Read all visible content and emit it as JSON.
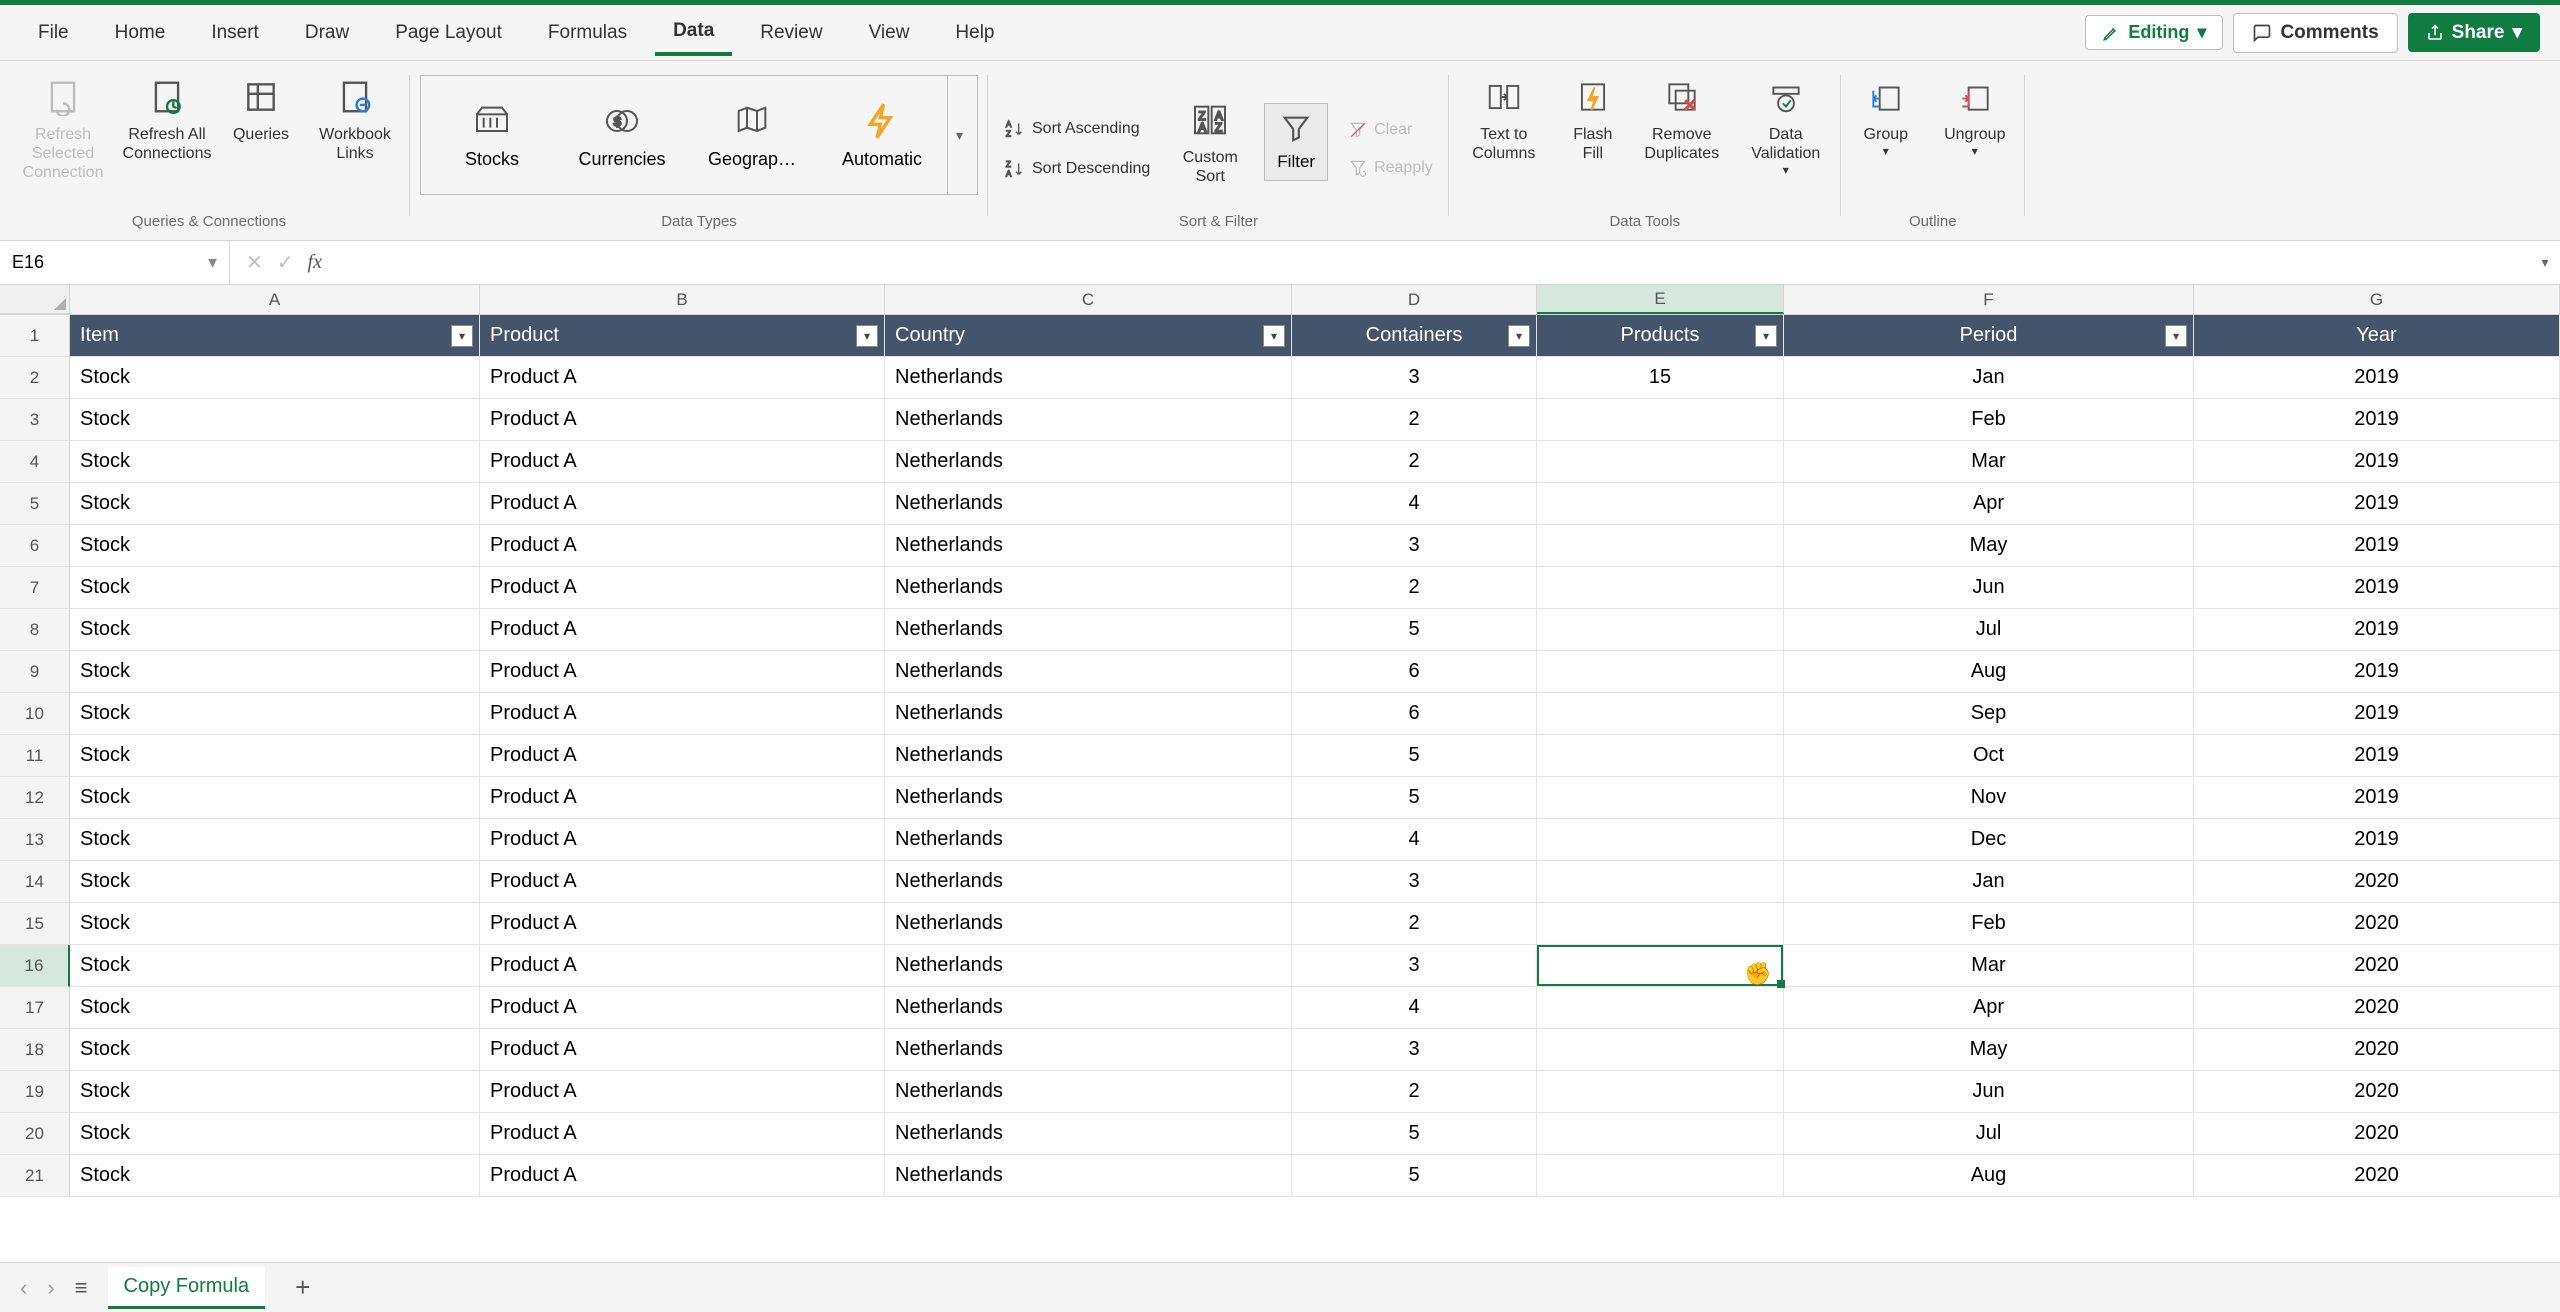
{
  "menu": {
    "file": "File",
    "home": "Home",
    "insert": "Insert",
    "draw": "Draw",
    "page_layout": "Page Layout",
    "formulas": "Formulas",
    "data": "Data",
    "review": "Review",
    "view": "View",
    "help": "Help"
  },
  "topright": {
    "editing": "Editing",
    "comments": "Comments",
    "share": "Share"
  },
  "ribbon": {
    "refresh_selected": "Refresh Selected Connection",
    "refresh_all": "Refresh All Connections",
    "queries": "Queries",
    "workbook_links": "Workbook Links",
    "group_qc": "Queries & Connections",
    "dt_stocks": "Stocks",
    "dt_currencies": "Currencies",
    "dt_geography": "Geograp…",
    "dt_automatic": "Automatic",
    "group_dt": "Data Types",
    "sort_asc": "Sort Ascending",
    "sort_desc": "Sort Descending",
    "custom_sort": "Custom Sort",
    "filter": "Filter",
    "clear": "Clear",
    "reapply": "Reapply",
    "group_sf": "Sort & Filter",
    "text_cols": "Text to Columns",
    "flash_fill": "Flash Fill",
    "remove_dup": "Remove Duplicates",
    "data_val": "Data Validation",
    "group_tools": "Data Tools",
    "group": "Group",
    "ungroup": "Ungroup",
    "group_outline": "Outline"
  },
  "name_box": "E16",
  "formula": "",
  "columns": [
    "A",
    "B",
    "C",
    "D",
    "E",
    "F",
    "G"
  ],
  "col_widths": [
    "cw-A",
    "cw-B",
    "cw-C",
    "cw-D",
    "cw-E",
    "cw-F",
    "cw-G"
  ],
  "headers": [
    "Item",
    "Product",
    "Country",
    "Containers",
    "Products",
    "Period",
    "Year"
  ],
  "filterable": [
    true,
    true,
    true,
    true,
    true,
    true,
    false
  ],
  "align": [
    "left",
    "left",
    "left",
    "center",
    "center",
    "center",
    "center"
  ],
  "rows": [
    [
      "Stock",
      "Product A",
      "Netherlands",
      "3",
      "15",
      "Jan",
      "2019"
    ],
    [
      "Stock",
      "Product A",
      "Netherlands",
      "2",
      "",
      "Feb",
      "2019"
    ],
    [
      "Stock",
      "Product A",
      "Netherlands",
      "2",
      "",
      "Mar",
      "2019"
    ],
    [
      "Stock",
      "Product A",
      "Netherlands",
      "4",
      "",
      "Apr",
      "2019"
    ],
    [
      "Stock",
      "Product A",
      "Netherlands",
      "3",
      "",
      "May",
      "2019"
    ],
    [
      "Stock",
      "Product A",
      "Netherlands",
      "2",
      "",
      "Jun",
      "2019"
    ],
    [
      "Stock",
      "Product A",
      "Netherlands",
      "5",
      "",
      "Jul",
      "2019"
    ],
    [
      "Stock",
      "Product A",
      "Netherlands",
      "6",
      "",
      "Aug",
      "2019"
    ],
    [
      "Stock",
      "Product A",
      "Netherlands",
      "6",
      "",
      "Sep",
      "2019"
    ],
    [
      "Stock",
      "Product A",
      "Netherlands",
      "5",
      "",
      "Oct",
      "2019"
    ],
    [
      "Stock",
      "Product A",
      "Netherlands",
      "5",
      "",
      "Nov",
      "2019"
    ],
    [
      "Stock",
      "Product A",
      "Netherlands",
      "4",
      "",
      "Dec",
      "2019"
    ],
    [
      "Stock",
      "Product A",
      "Netherlands",
      "3",
      "",
      "Jan",
      "2020"
    ],
    [
      "Stock",
      "Product A",
      "Netherlands",
      "2",
      "",
      "Feb",
      "2020"
    ],
    [
      "Stock",
      "Product A",
      "Netherlands",
      "3",
      "",
      "Mar",
      "2020"
    ],
    [
      "Stock",
      "Product A",
      "Netherlands",
      "4",
      "",
      "Apr",
      "2020"
    ],
    [
      "Stock",
      "Product A",
      "Netherlands",
      "3",
      "",
      "May",
      "2020"
    ],
    [
      "Stock",
      "Product A",
      "Netherlands",
      "2",
      "",
      "Jun",
      "2020"
    ],
    [
      "Stock",
      "Product A",
      "Netherlands",
      "5",
      "",
      "Jul",
      "2020"
    ],
    [
      "Stock",
      "Product A",
      "Netherlands",
      "5",
      "",
      "Aug",
      "2020"
    ]
  ],
  "active_cell": {
    "row": 16,
    "col": "E"
  },
  "sheet": {
    "name": "Copy Formula"
  }
}
